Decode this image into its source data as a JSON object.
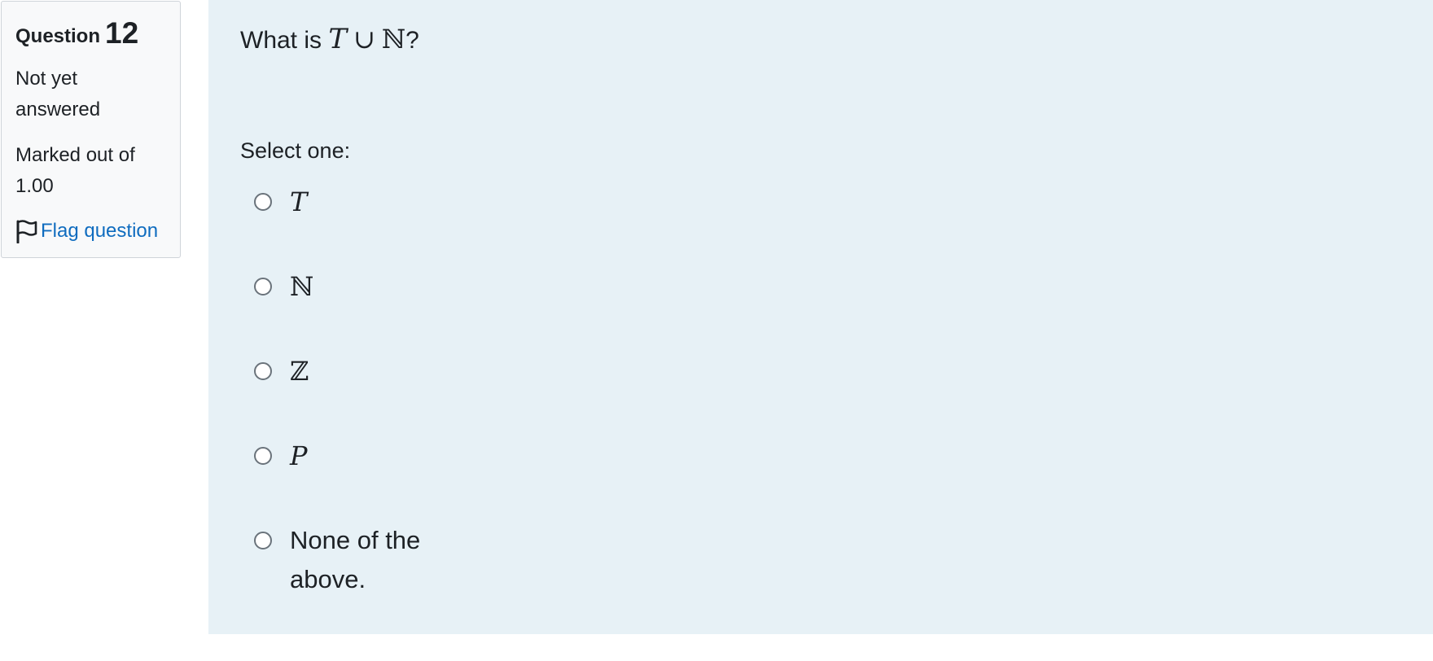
{
  "info": {
    "question_word": "Question",
    "question_number": "12",
    "state": "Not yet answered",
    "grade": "Marked out of 1.00",
    "flag_label": "Flag question"
  },
  "question": {
    "text_before": "What is ",
    "set_a": "T",
    "union_symbol": "∪",
    "set_b": "ℕ",
    "text_after": "?",
    "prompt": "Select one:"
  },
  "options": [
    {
      "label": "T"
    },
    {
      "label": "ℕ"
    },
    {
      "label": "ℤ"
    },
    {
      "label": "P"
    },
    {
      "label": "None of the above."
    }
  ],
  "colors": {
    "panel_bg": "#e7f1f6",
    "info_bg": "#f8f9fa",
    "link": "#0f6cbf"
  },
  "icons": {
    "flag": "flag-icon"
  }
}
